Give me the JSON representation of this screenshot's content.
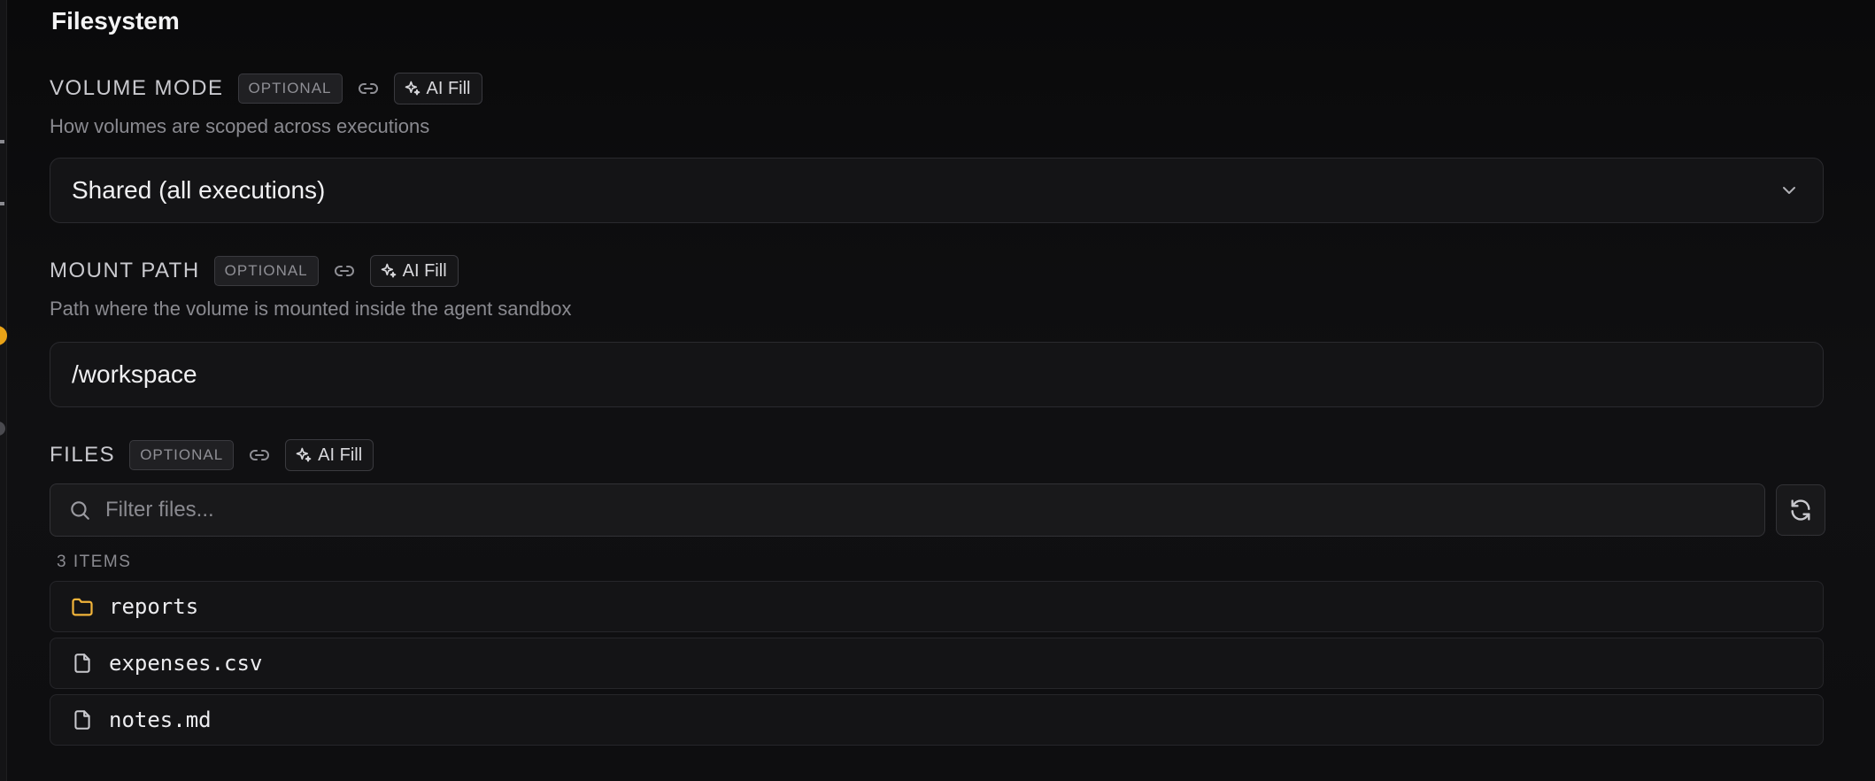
{
  "section": {
    "title": "Filesystem"
  },
  "fields": {
    "volume_mode": {
      "label": "VOLUME MODE",
      "badge": "OPTIONAL",
      "ai_fill_label": "AI Fill",
      "help": "How volumes are scoped across executions",
      "selected_value": "Shared (all executions)"
    },
    "mount_path": {
      "label": "MOUNT PATH",
      "badge": "OPTIONAL",
      "ai_fill_label": "AI Fill",
      "help": "Path where the volume is mounted inside the agent sandbox",
      "value": "/workspace"
    },
    "files": {
      "label": "FILES",
      "badge": "OPTIONAL",
      "ai_fill_label": "AI Fill",
      "filter_placeholder": "Filter files...",
      "filter_value": "",
      "count_label": "3 ITEMS",
      "items": [
        {
          "name": "reports",
          "kind": "folder",
          "icon": "folder-icon"
        },
        {
          "name": "expenses.csv",
          "kind": "file",
          "icon": "file-icon"
        },
        {
          "name": "notes.md",
          "kind": "file",
          "icon": "file-icon"
        }
      ]
    }
  },
  "colors": {
    "background": "#0b0b0c",
    "folder_accent": "#f2b43a",
    "rail_accent": "#e8a217"
  }
}
